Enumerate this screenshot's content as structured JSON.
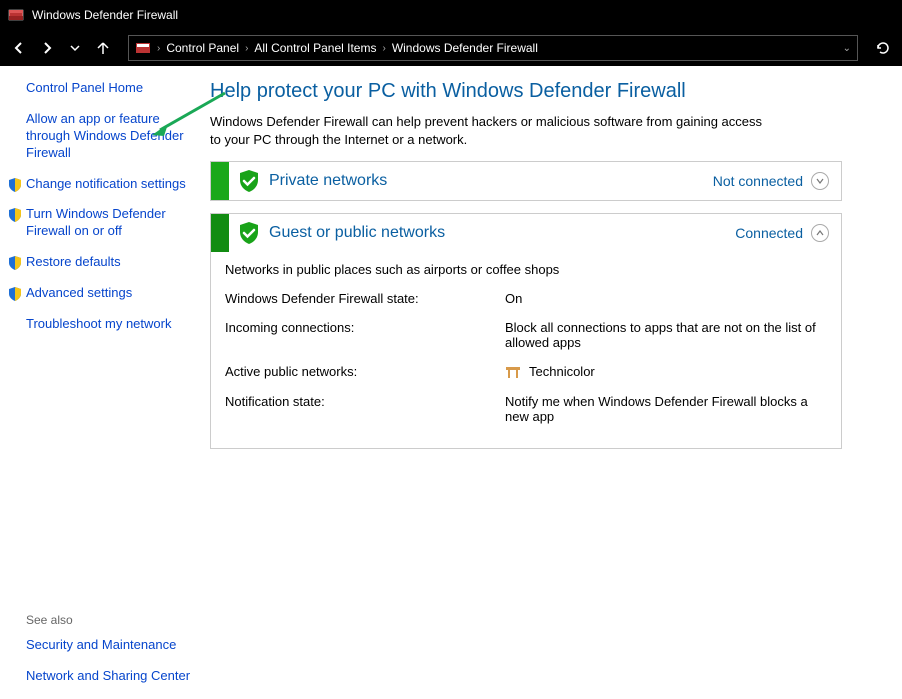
{
  "window": {
    "title": "Windows Defender Firewall"
  },
  "breadcrumb": {
    "items": [
      "Control Panel",
      "All Control Panel Items",
      "Windows Defender Firewall"
    ]
  },
  "sidebar": {
    "home": "Control Panel Home",
    "links": [
      {
        "label": "Allow an app or feature through Windows Defender Firewall",
        "shield": false
      },
      {
        "label": "Change notification settings",
        "shield": true
      },
      {
        "label": "Turn Windows Defender Firewall on or off",
        "shield": true
      },
      {
        "label": "Restore defaults",
        "shield": true
      },
      {
        "label": "Advanced settings",
        "shield": true
      },
      {
        "label": "Troubleshoot my network",
        "shield": false
      }
    ],
    "see_also_label": "See also",
    "see_also": [
      "Security and Maintenance",
      "Network and Sharing Center"
    ]
  },
  "main": {
    "title": "Help protect your PC with Windows Defender Firewall",
    "desc": "Windows Defender Firewall can help prevent hackers or malicious software from gaining access to your PC through the Internet or a network.",
    "private": {
      "label": "Private networks",
      "status": "Not connected"
    },
    "public": {
      "label": "Guest or public networks",
      "status": "Connected",
      "desc": "Networks in public places such as airports or coffee shops",
      "rows": {
        "fw_state_k": "Windows Defender Firewall state:",
        "fw_state_v": "On",
        "incoming_k": "Incoming connections:",
        "incoming_v": "Block all connections to apps that are not on the list of allowed apps",
        "active_k": "Active public networks:",
        "active_v": "Technicolor",
        "notif_k": "Notification state:",
        "notif_v": "Notify me when Windows Defender Firewall blocks a new app"
      }
    }
  }
}
